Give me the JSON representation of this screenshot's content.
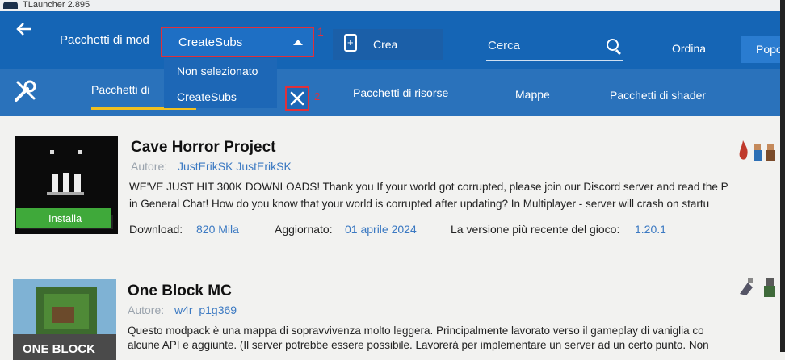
{
  "window": {
    "title": "TLauncher 2.895"
  },
  "header": {
    "mode_label": "Pacchetti di mod",
    "selector_value": "CreateSubs",
    "marker_1": "1",
    "create_label": "Crea",
    "search_placeholder": "Cerca",
    "sort_label": "Ordina",
    "popular_label": "Popo"
  },
  "dropdown": {
    "items": [
      "Non selezionato",
      "CreateSubs"
    ],
    "marker_2": "2"
  },
  "tabs": [
    "Pacchetti di",
    "Pacchetti di risorse",
    "Mappe",
    "Pacchetti di shader"
  ],
  "packs": [
    {
      "title": "Cave Horror Project",
      "author_label": "Autore:",
      "author": "JustErikSK JustErikSK",
      "description_1": "WE'VE JUST HIT 300K DOWNLOADS! Thank you If your world got corrupted, please join our Discord server and read the P",
      "description_2": "in General Chat! How do you know that your world is corrupted after updating? In Multiplayer - server will crash on startu",
      "download_label": "Download:",
      "download_value": "820 Mila",
      "updated_label": "Aggiornato:",
      "updated_value": "01 aprile 2024",
      "version_label": "La versione più recente del gioco:",
      "version_value": "1.20.1",
      "install_label": "Installa"
    },
    {
      "title": "One Block MC",
      "author_label": "Autore:",
      "author": "w4r_p1g369",
      "description_1": "Questo modpack è una mappa di sopravvivenza molto leggera. Principalmente lavorato verso il gameplay di vaniglia co",
      "description_2": "alcune API e aggiunte. (Il server potrebbe essere possibile. Lavorerà per implementare un server ad un certo punto. Non",
      "image_caption": "ONE BLOCK"
    }
  ],
  "colors": {
    "header_bg": "#1565b5",
    "accent_tab": "#f0c020",
    "highlight": "#e0303a",
    "install_bg": "#3fa93a",
    "link": "#3b79c2"
  }
}
